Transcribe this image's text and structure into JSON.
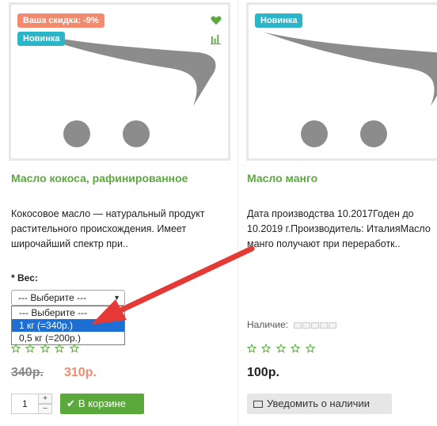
{
  "colors": {
    "accent_green": "#5ba93d",
    "discount_badge": "#f28a6e",
    "new_badge": "#2ab5c9",
    "sale_price": "#f28a6e",
    "select_highlight": "#1e6fd4",
    "annotation_arrow": "#e53935"
  },
  "products": [
    {
      "badge_discount": "Ваша скидка: -9%",
      "badge_new": "Новинка",
      "wishlist_icon": "heart-icon",
      "compare_icon": "bar-chart-icon",
      "title": "Масло кокоса, рафинированное",
      "description": "Кокосовое масло  — натуральный продукт растительного происхождения. Имеет широчайший спектр при..",
      "option_required": "*",
      "option_label": "Вес:",
      "select_value": "--- Выберите ---",
      "select_options": [
        "--- Выберите ---",
        "1 кг (=340р.)",
        "0,5 кг (=200р.)"
      ],
      "selected_option_index": 1,
      "rating": 0,
      "rating_max": 5,
      "price_old": "340р.",
      "price_new": "310р.",
      "quantity": "1",
      "qty_plus": "+",
      "qty_minus": "−",
      "cart_button": "В корзине"
    },
    {
      "badge_new": "Новинка",
      "title": "Масло манго",
      "description": "Дата производства 10.2017Годен до 10.2019 г.Производитель: ИталияМасло манго получают при переработк..",
      "availability_label": "Наличие:",
      "availability_level": 0,
      "rating": 0,
      "rating_max": 5,
      "price": "100р.",
      "notify_button": "Уведомить о наличии"
    }
  ]
}
